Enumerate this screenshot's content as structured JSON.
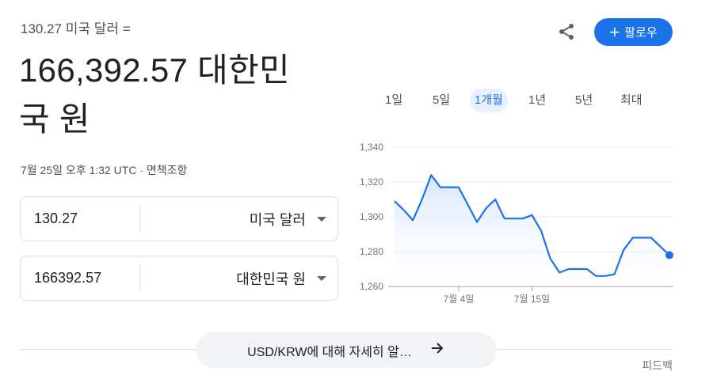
{
  "header": {
    "subtitle": "130.27 미국 달러 =",
    "big_value_line1": "166,392.57 대한민",
    "big_value_line2": "국 원",
    "timestamp": "7월 25일 오후 1:32 UTC",
    "separator": "·",
    "disclaimer": "면책조항"
  },
  "actions": {
    "share_icon": "share-icon",
    "follow_label": "팔로우",
    "follow_icon": "+"
  },
  "converter": {
    "from_amount": "130.27",
    "from_currency": "미국 달러",
    "to_amount": "166392.57",
    "to_currency": "대한민국 원"
  },
  "ranges": [
    {
      "label": "1일",
      "active": false
    },
    {
      "label": "5일",
      "active": false
    },
    {
      "label": "1개월",
      "active": true
    },
    {
      "label": "1년",
      "active": false
    },
    {
      "label": "5년",
      "active": false
    },
    {
      "label": "최대",
      "active": false
    }
  ],
  "chart_data": {
    "type": "line",
    "ylim": [
      1260,
      1340
    ],
    "yticks": [
      "1,260",
      "1,280",
      "1,300",
      "1,320",
      "1,340"
    ],
    "ytick_values": [
      1260,
      1280,
      1300,
      1320,
      1340
    ],
    "xtick_labels": [
      "7월 4일",
      "7월 15일"
    ],
    "xtick_index": [
      7,
      15
    ],
    "values": [
      1309,
      1304,
      1298,
      1310,
      1324,
      1317,
      1317,
      1317,
      1307,
      1297,
      1305,
      1310,
      1299,
      1299,
      1299,
      1301,
      1292,
      1276,
      1268,
      1270,
      1270,
      1270,
      1266,
      1266,
      1267,
      1281,
      1288,
      1288,
      1288,
      1283,
      1278
    ],
    "grid": true,
    "line_color": "#1a73e8",
    "fill": "#e8f0fe"
  },
  "footer": {
    "more_label": "USD/KRW에 대해 자세히 알…",
    "more_icon": "arrow-right-icon",
    "feedback_label": "피드백"
  },
  "colors": {
    "accent": "#1a73e8"
  }
}
